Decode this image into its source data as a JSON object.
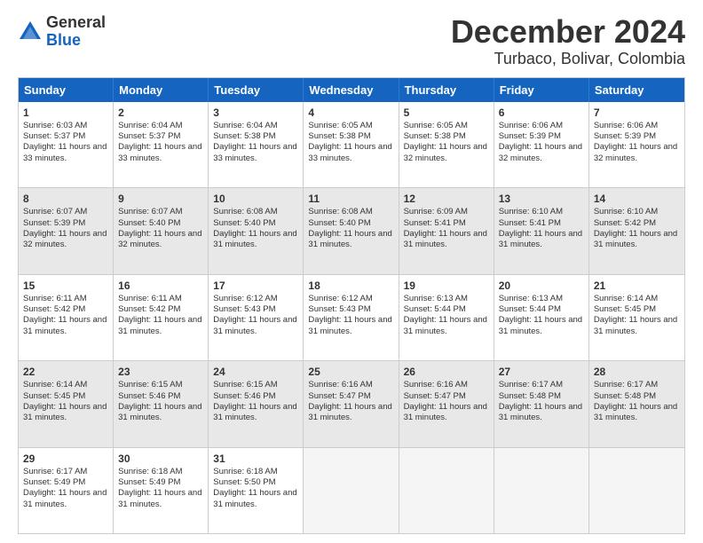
{
  "logo": {
    "general": "General",
    "blue": "Blue"
  },
  "title": "December 2024",
  "subtitle": "Turbaco, Bolivar, Colombia",
  "headers": [
    "Sunday",
    "Monday",
    "Tuesday",
    "Wednesday",
    "Thursday",
    "Friday",
    "Saturday"
  ],
  "rows": [
    [
      {
        "day": "1",
        "sunrise": "6:03 AM",
        "sunset": "5:37 PM",
        "daylight": "11 hours and 33 minutes.",
        "shaded": false
      },
      {
        "day": "2",
        "sunrise": "6:04 AM",
        "sunset": "5:37 PM",
        "daylight": "11 hours and 33 minutes.",
        "shaded": false
      },
      {
        "day": "3",
        "sunrise": "6:04 AM",
        "sunset": "5:38 PM",
        "daylight": "11 hours and 33 minutes.",
        "shaded": false
      },
      {
        "day": "4",
        "sunrise": "6:05 AM",
        "sunset": "5:38 PM",
        "daylight": "11 hours and 33 minutes.",
        "shaded": false
      },
      {
        "day": "5",
        "sunrise": "6:05 AM",
        "sunset": "5:38 PM",
        "daylight": "11 hours and 32 minutes.",
        "shaded": false
      },
      {
        "day": "6",
        "sunrise": "6:06 AM",
        "sunset": "5:39 PM",
        "daylight": "11 hours and 32 minutes.",
        "shaded": false
      },
      {
        "day": "7",
        "sunrise": "6:06 AM",
        "sunset": "5:39 PM",
        "daylight": "11 hours and 32 minutes.",
        "shaded": false
      }
    ],
    [
      {
        "day": "8",
        "sunrise": "6:07 AM",
        "sunset": "5:39 PM",
        "daylight": "11 hours and 32 minutes.",
        "shaded": true
      },
      {
        "day": "9",
        "sunrise": "6:07 AM",
        "sunset": "5:40 PM",
        "daylight": "11 hours and 32 minutes.",
        "shaded": true
      },
      {
        "day": "10",
        "sunrise": "6:08 AM",
        "sunset": "5:40 PM",
        "daylight": "11 hours and 31 minutes.",
        "shaded": true
      },
      {
        "day": "11",
        "sunrise": "6:08 AM",
        "sunset": "5:40 PM",
        "daylight": "11 hours and 31 minutes.",
        "shaded": true
      },
      {
        "day": "12",
        "sunrise": "6:09 AM",
        "sunset": "5:41 PM",
        "daylight": "11 hours and 31 minutes.",
        "shaded": true
      },
      {
        "day": "13",
        "sunrise": "6:10 AM",
        "sunset": "5:41 PM",
        "daylight": "11 hours and 31 minutes.",
        "shaded": true
      },
      {
        "day": "14",
        "sunrise": "6:10 AM",
        "sunset": "5:42 PM",
        "daylight": "11 hours and 31 minutes.",
        "shaded": true
      }
    ],
    [
      {
        "day": "15",
        "sunrise": "6:11 AM",
        "sunset": "5:42 PM",
        "daylight": "11 hours and 31 minutes.",
        "shaded": false
      },
      {
        "day": "16",
        "sunrise": "6:11 AM",
        "sunset": "5:42 PM",
        "daylight": "11 hours and 31 minutes.",
        "shaded": false
      },
      {
        "day": "17",
        "sunrise": "6:12 AM",
        "sunset": "5:43 PM",
        "daylight": "11 hours and 31 minutes.",
        "shaded": false
      },
      {
        "day": "18",
        "sunrise": "6:12 AM",
        "sunset": "5:43 PM",
        "daylight": "11 hours and 31 minutes.",
        "shaded": false
      },
      {
        "day": "19",
        "sunrise": "6:13 AM",
        "sunset": "5:44 PM",
        "daylight": "11 hours and 31 minutes.",
        "shaded": false
      },
      {
        "day": "20",
        "sunrise": "6:13 AM",
        "sunset": "5:44 PM",
        "daylight": "11 hours and 31 minutes.",
        "shaded": false
      },
      {
        "day": "21",
        "sunrise": "6:14 AM",
        "sunset": "5:45 PM",
        "daylight": "11 hours and 31 minutes.",
        "shaded": false
      }
    ],
    [
      {
        "day": "22",
        "sunrise": "6:14 AM",
        "sunset": "5:45 PM",
        "daylight": "11 hours and 31 minutes.",
        "shaded": true
      },
      {
        "day": "23",
        "sunrise": "6:15 AM",
        "sunset": "5:46 PM",
        "daylight": "11 hours and 31 minutes.",
        "shaded": true
      },
      {
        "day": "24",
        "sunrise": "6:15 AM",
        "sunset": "5:46 PM",
        "daylight": "11 hours and 31 minutes.",
        "shaded": true
      },
      {
        "day": "25",
        "sunrise": "6:16 AM",
        "sunset": "5:47 PM",
        "daylight": "11 hours and 31 minutes.",
        "shaded": true
      },
      {
        "day": "26",
        "sunrise": "6:16 AM",
        "sunset": "5:47 PM",
        "daylight": "11 hours and 31 minutes.",
        "shaded": true
      },
      {
        "day": "27",
        "sunrise": "6:17 AM",
        "sunset": "5:48 PM",
        "daylight": "11 hours and 31 minutes.",
        "shaded": true
      },
      {
        "day": "28",
        "sunrise": "6:17 AM",
        "sunset": "5:48 PM",
        "daylight": "11 hours and 31 minutes.",
        "shaded": true
      }
    ],
    [
      {
        "day": "29",
        "sunrise": "6:17 AM",
        "sunset": "5:49 PM",
        "daylight": "11 hours and 31 minutes.",
        "shaded": false
      },
      {
        "day": "30",
        "sunrise": "6:18 AM",
        "sunset": "5:49 PM",
        "daylight": "11 hours and 31 minutes.",
        "shaded": false
      },
      {
        "day": "31",
        "sunrise": "6:18 AM",
        "sunset": "5:50 PM",
        "daylight": "11 hours and 31 minutes.",
        "shaded": false
      },
      {
        "day": "",
        "sunrise": "",
        "sunset": "",
        "daylight": "",
        "shaded": false,
        "empty": true
      },
      {
        "day": "",
        "sunrise": "",
        "sunset": "",
        "daylight": "",
        "shaded": false,
        "empty": true
      },
      {
        "day": "",
        "sunrise": "",
        "sunset": "",
        "daylight": "",
        "shaded": false,
        "empty": true
      },
      {
        "day": "",
        "sunrise": "",
        "sunset": "",
        "daylight": "",
        "shaded": false,
        "empty": true
      }
    ]
  ]
}
